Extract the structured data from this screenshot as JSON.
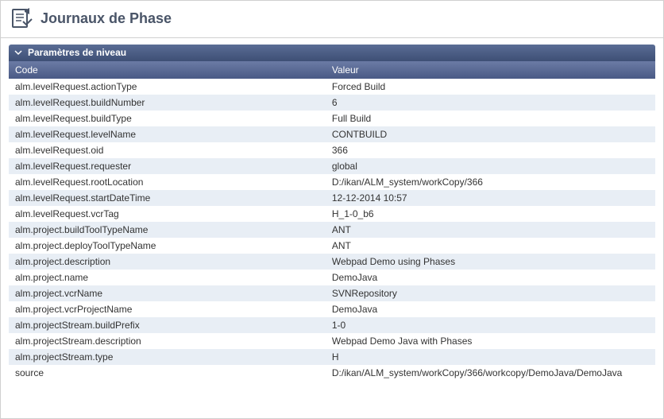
{
  "header": {
    "title": "Journaux de Phase"
  },
  "panel": {
    "title": "Paramètres de niveau"
  },
  "table": {
    "columns": {
      "code": "Code",
      "value": "Valeur"
    },
    "rows": [
      {
        "code": "alm.levelRequest.actionType",
        "value": "Forced Build"
      },
      {
        "code": "alm.levelRequest.buildNumber",
        "value": "6"
      },
      {
        "code": "alm.levelRequest.buildType",
        "value": "Full Build"
      },
      {
        "code": "alm.levelRequest.levelName",
        "value": "CONTBUILD"
      },
      {
        "code": "alm.levelRequest.oid",
        "value": "366"
      },
      {
        "code": "alm.levelRequest.requester",
        "value": "global"
      },
      {
        "code": "alm.levelRequest.rootLocation",
        "value": "D:/ikan/ALM_system/workCopy/366"
      },
      {
        "code": "alm.levelRequest.startDateTime",
        "value": "12-12-2014 10:57"
      },
      {
        "code": "alm.levelRequest.vcrTag",
        "value": "H_1-0_b6"
      },
      {
        "code": "alm.project.buildToolTypeName",
        "value": "ANT"
      },
      {
        "code": "alm.project.deployToolTypeName",
        "value": "ANT"
      },
      {
        "code": "alm.project.description",
        "value": "Webpad Demo using Phases"
      },
      {
        "code": "alm.project.name",
        "value": "DemoJava"
      },
      {
        "code": "alm.project.vcrName",
        "value": "SVNRepository"
      },
      {
        "code": "alm.project.vcrProjectName",
        "value": "DemoJava"
      },
      {
        "code": "alm.projectStream.buildPrefix",
        "value": "1-0"
      },
      {
        "code": "alm.projectStream.description",
        "value": "Webpad Demo Java with Phases"
      },
      {
        "code": "alm.projectStream.type",
        "value": "H"
      },
      {
        "code": "source",
        "value": "D:/ikan/ALM_system/workCopy/366/workcopy/DemoJava/DemoJava"
      }
    ]
  }
}
